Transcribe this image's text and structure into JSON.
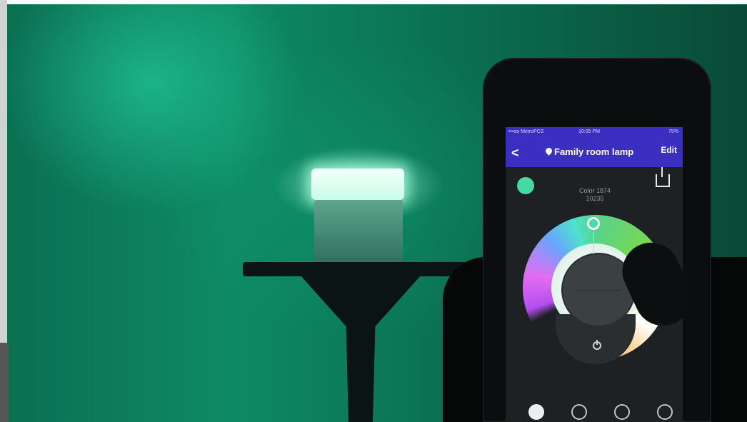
{
  "phone_app": {
    "status": {
      "carrier": "•••oo MetroPCS",
      "time": "10:05 PM",
      "battery": "75%"
    },
    "nav": {
      "title": "Family room lamp",
      "edit": "Edit"
    },
    "color_label": "Color 1874",
    "color_sub": "10235",
    "colors": {
      "nav_bg": "#3a2fc0",
      "swatch": "#47d8a6"
    }
  }
}
